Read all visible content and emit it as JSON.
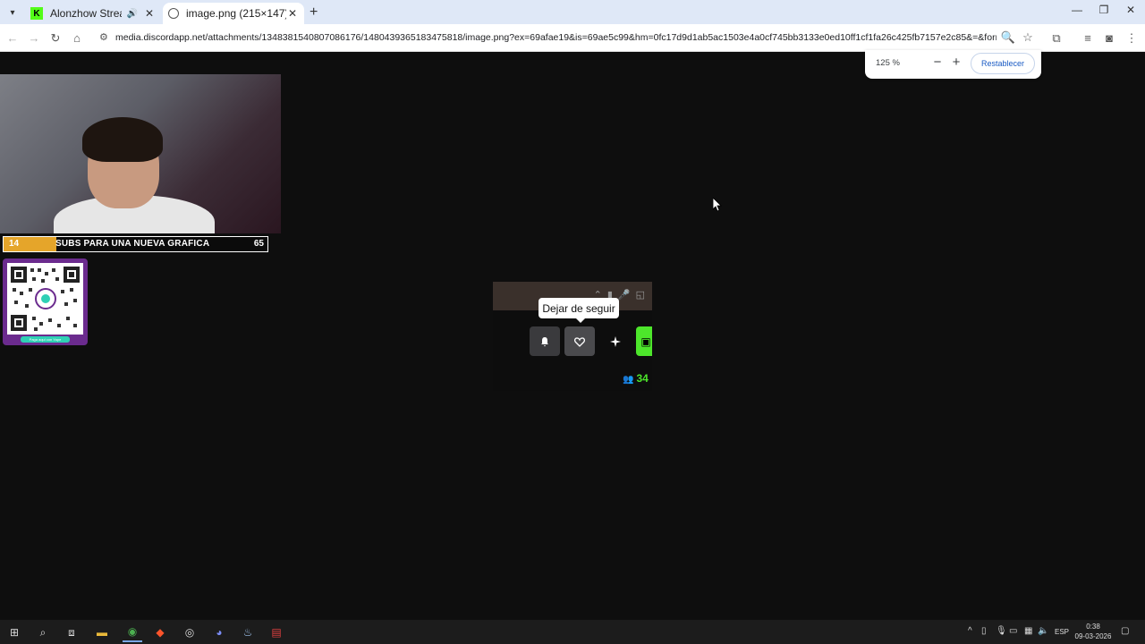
{
  "browser": {
    "tabs": [
      {
        "title": "Alonzhow Stream - Watch l",
        "active": false,
        "audio": true
      },
      {
        "title": "image.png (215×147)",
        "active": true,
        "audio": false
      }
    ],
    "url": "media.discordapp.net/attachments/1348381540807086176/1480439365183475818/image.png?ex=69afae19&is=69ae5c99&hm=0fc17d9d1ab5ac1503e4a0cf745bb3133e0ed10ff1cf1fa26c425fb7157e2c85&=&format=webp&quality=lossl..."
  },
  "zoom": {
    "level": "125 %",
    "minus": "−",
    "plus": "+",
    "reset_label": "Restablecer"
  },
  "stream": {
    "goal": {
      "current": "14",
      "label": "SUBS PARA UNA NUEVA GRAFICA",
      "target": "65",
      "progress_fraction": 0.2
    },
    "qr_caption": "Paga aqui con Yape"
  },
  "screenshot": {
    "tooltip": "Dejar de seguir",
    "viewer_count": "34"
  },
  "taskbar": {
    "language": "ESP",
    "time": "0:38",
    "date": "09-03-2026"
  },
  "colors": {
    "accent_green": "#4de62b",
    "goal_fill": "#e5a52a",
    "qr_frame": "#6b2b8e",
    "link_blue": "#1a5bc4"
  }
}
